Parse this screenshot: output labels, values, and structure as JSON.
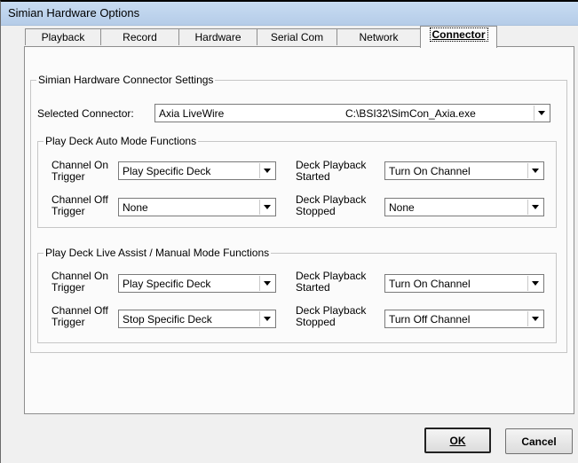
{
  "window": {
    "title": "Simian Hardware Options"
  },
  "tabs": [
    {
      "label": "Playback",
      "active": false
    },
    {
      "label": "Record",
      "active": false
    },
    {
      "label": "Hardware",
      "active": false
    },
    {
      "label": "Serial Com",
      "active": false
    },
    {
      "label": "Network",
      "active": false
    },
    {
      "label": "Connector",
      "active": true
    }
  ],
  "connector_settings": {
    "legend": "Simian Hardware Connector Settings",
    "selected_connector_label": "Selected Connector:",
    "selected_connector": {
      "name": "Axia LiveWire",
      "path": "C:\\BSI32\\SimCon_Axia.exe"
    }
  },
  "auto_mode": {
    "legend": "Play Deck Auto Mode Functions",
    "channel_on_trigger": {
      "label": "Channel On Trigger",
      "value": "Play Specific Deck"
    },
    "channel_off_trigger": {
      "label": "Channel Off Trigger",
      "value": "None"
    },
    "deck_playback_started": {
      "label": "Deck Playback Started",
      "value": "Turn On Channel"
    },
    "deck_playback_stopped": {
      "label": "Deck Playback Stopped",
      "value": "None"
    }
  },
  "manual_mode": {
    "legend": "Play Deck Live Assist / Manual Mode Functions",
    "channel_on_trigger": {
      "label": "Channel On Trigger",
      "value": "Play Specific Deck"
    },
    "channel_off_trigger": {
      "label": "Channel Off Trigger",
      "value": "Stop Specific Deck"
    },
    "deck_playback_started": {
      "label": "Deck Playback Started",
      "value": "Turn On Channel"
    },
    "deck_playback_stopped": {
      "label": "Deck Playback Stopped",
      "value": "Turn Off Channel"
    }
  },
  "buttons": {
    "ok": "OK",
    "cancel": "Cancel"
  }
}
